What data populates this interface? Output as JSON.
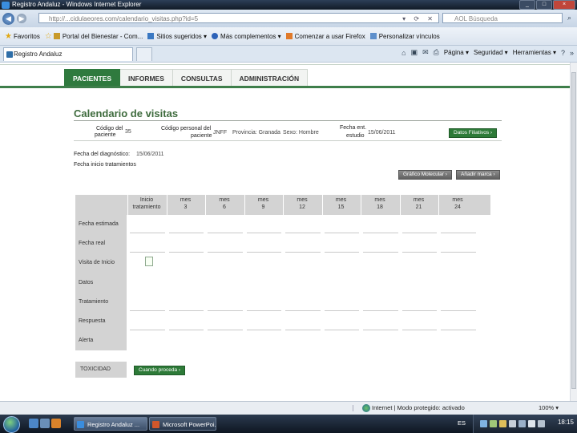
{
  "window": {
    "title": "Registro Andaluz - Windows Internet Explorer",
    "controls": [
      "_",
      "□",
      "×"
    ]
  },
  "browser": {
    "url": "http://...cidulaeores.com/calendario_visitas.php?id=5",
    "search_placeholder": "AOL Búsqueda",
    "favorites": [
      {
        "label": "Favoritos",
        "icon": "star-icon"
      },
      {
        "label": "Portal del Bienestar - Com...",
        "icon": "page-icon"
      },
      {
        "label": "Sitios sugeridos ▾",
        "icon": "page-icon"
      },
      {
        "label": "Más complementos ▾",
        "icon": "ie-icon"
      },
      {
        "label": "Comenzar a usar Firefox",
        "icon": "page-icon"
      },
      {
        "label": "Personalizar vínculos",
        "icon": "page-icon"
      }
    ],
    "tab_title": "Registro Andaluz",
    "commands": [
      "Página ▾",
      "Seguridad ▾",
      "Herramientas ▾"
    ]
  },
  "app": {
    "nav_tabs": [
      {
        "label": "PACIENTES",
        "active": true
      },
      {
        "label": "INFORMES",
        "active": false
      },
      {
        "label": "CONSULTAS",
        "active": false
      },
      {
        "label": "ADMINISTRACIÓN",
        "active": false
      }
    ],
    "page_title": "Calendario de visitas",
    "fields": {
      "codigo_paciente_label_1": "Código del",
      "codigo_paciente_label_2": "paciente",
      "codigo_paciente_value": "35",
      "codigo_personal_label_1": "Código personal del",
      "codigo_personal_label_2": "paciente",
      "codigo_personal_value": "JNFF",
      "provincia": "Provincia: Granada",
      "sexo": "Sexo: Hombre",
      "fecha_ent_label_1": "Fecha ent.",
      "fecha_ent_label_2": "estudio",
      "fecha_ent_value": "15/06/2011",
      "fecha_diagnostico_label": "Fecha del diagnóstico:",
      "fecha_diagnostico_value": "15/06/2011",
      "fecha_inicio_label": "Fecha inicio tratamientos"
    },
    "buttons": {
      "datos_filiativos": "Datos Filiativos ›",
      "grafico_molecular": "Gráfico Molecular ›",
      "anadir_marca": "Añadir marca ›",
      "cuando_proceda": "Cuando proceda ›"
    },
    "calendar": {
      "columns": [
        {
          "l1": "Inicio",
          "l2": "tratamiento"
        },
        {
          "l1": "mes",
          "l2": "3"
        },
        {
          "l1": "mes",
          "l2": "6"
        },
        {
          "l1": "mes",
          "l2": "9"
        },
        {
          "l1": "mes",
          "l2": "12"
        },
        {
          "l1": "mes",
          "l2": "15"
        },
        {
          "l1": "mes",
          "l2": "18"
        },
        {
          "l1": "mes",
          "l2": "21"
        },
        {
          "l1": "mes",
          "l2": "24"
        }
      ],
      "rows": [
        "Fecha estimada",
        "Fecha real",
        "Visita de Inicio",
        "Datos",
        "Tratamiento",
        "Respuesta",
        "Alerta"
      ]
    },
    "toxicidad_label": "TOXICIDAD"
  },
  "statusbar": {
    "zone": "Internet | Modo protegido: activado",
    "zoom": "100% ▾"
  },
  "taskbar": {
    "tasks": [
      {
        "label": "Registro Andaluz ...",
        "active": true
      },
      {
        "label": "Microsoft PowerPoi...",
        "active": false
      }
    ],
    "tray_language": "ES",
    "clock": "18:15"
  }
}
